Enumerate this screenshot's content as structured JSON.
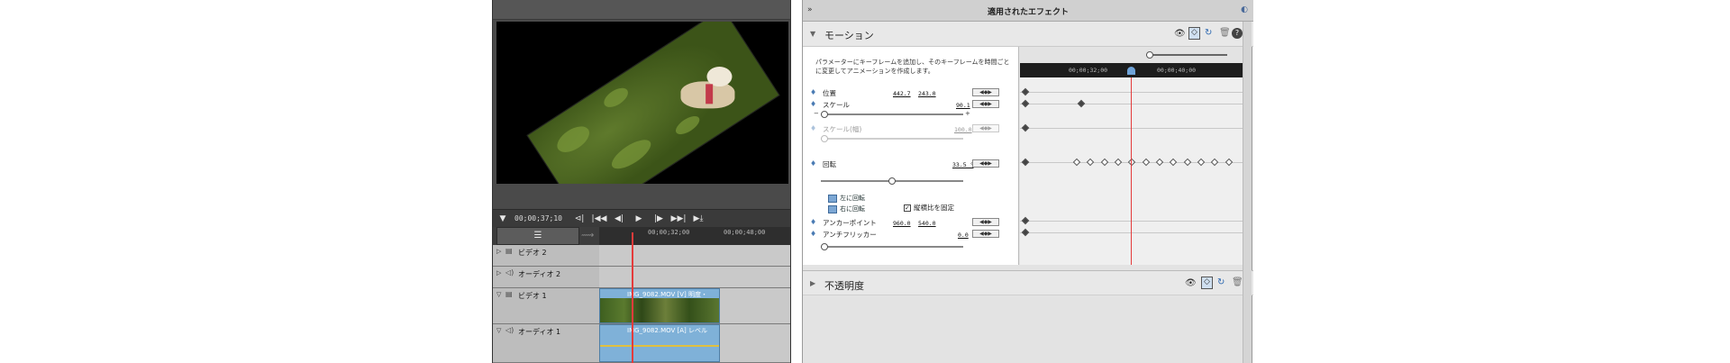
{
  "monitor": {
    "timecode": "00;00;37;10"
  },
  "transport": {
    "buttons": [
      "▼",
      "⊲|",
      "|◀◀",
      "◀|",
      "▶",
      "|▶",
      "▶▶|",
      "▶⤓"
    ]
  },
  "timeline": {
    "ruler": {
      "t1": "00;00;32;00",
      "t2": "00;00;48;00"
    },
    "tracks": [
      {
        "name": "ビデオ 2",
        "icon": "▤"
      },
      {
        "name": "オーディオ 2",
        "icon": "◁)"
      },
      {
        "name": "ビデオ 1",
        "icon": "▤",
        "clip": "IMG_9082.MOV [V] 明度・"
      },
      {
        "name": "オーディオ 1",
        "icon": "◁)",
        "clip": "IMG_9082.MOV [A] レベル"
      }
    ]
  },
  "effects": {
    "title": "適用されたエフェクト",
    "motion": {
      "label": "モーション",
      "help": "パラメーターにキーフレームを追加し、そのキーフレームを時間ごとに変更してアニメーションを作成します。",
      "props": {
        "position": {
          "label": "位置",
          "x": "442.7",
          "y": "243.0"
        },
        "scale": {
          "label": "スケール",
          "value": "90.1"
        },
        "scale_w": {
          "label": "スケール(幅)",
          "value": "100.0"
        },
        "uniform": "縦横比を固定",
        "rotation": {
          "label": "回転",
          "value": "33.5 °"
        },
        "rot_left": "左に回転",
        "rot_right": "右に回転",
        "anchor": {
          "label": "アンカーポイント",
          "x": "960.0",
          "y": "540.0"
        },
        "flicker": {
          "label": "アンチフリッカー",
          "value": "0.0"
        }
      },
      "kf_ruler": {
        "t1": "00;00;32;00",
        "t2": "00;00;40;00"
      }
    },
    "opacity": {
      "label": "不透明度"
    }
  }
}
